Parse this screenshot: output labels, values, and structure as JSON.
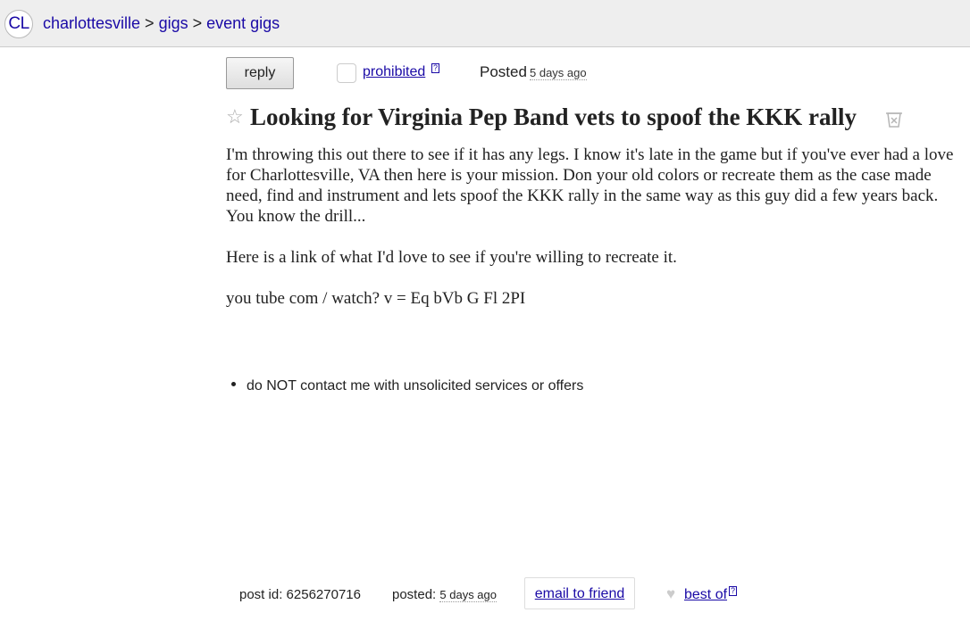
{
  "header": {
    "logo": "CL",
    "breadcrumbs": [
      {
        "label": "charlottesville"
      },
      {
        "label": "gigs"
      },
      {
        "label": "event gigs"
      }
    ],
    "separator": ">"
  },
  "actions": {
    "reply_label": "reply",
    "prohibited_label": "prohibited",
    "help_marker": "?",
    "posted_label": "Posted",
    "posted_time": "5 days ago"
  },
  "post": {
    "star_icon": "star-icon",
    "title": "Looking for Virginia Pep Band vets to spoof the KKK rally",
    "hide_icon": "hide-posting-icon",
    "body_paragraphs": [
      "I'm throwing this out there to see if it has any legs. I know it's late in the game but if you've ever had a love for Charlottesville, VA then here is your mission. Don your old colors or recreate them as the case made need, find and instrument and lets spoof the KKK rally in the same way as this guy did a few years back. You know the drill...",
      "Here is a link of what I'd love to see if you're willing to recreate it.",
      "you tube com / watch? v = Eq bVb G Fl 2PI"
    ],
    "notice": "do NOT contact me with unsolicited services or offers"
  },
  "footer": {
    "post_id_label": "post id:",
    "post_id": "6256270716",
    "posted_label": "posted:",
    "posted_time": "5 days ago",
    "email_label": "email to friend",
    "heart_icon": "heart-icon",
    "bestof_label": "best of",
    "help_marker": "?"
  },
  "colors": {
    "link": "#1a0aa6",
    "header_bg": "#eeeeee",
    "text": "#222222"
  }
}
